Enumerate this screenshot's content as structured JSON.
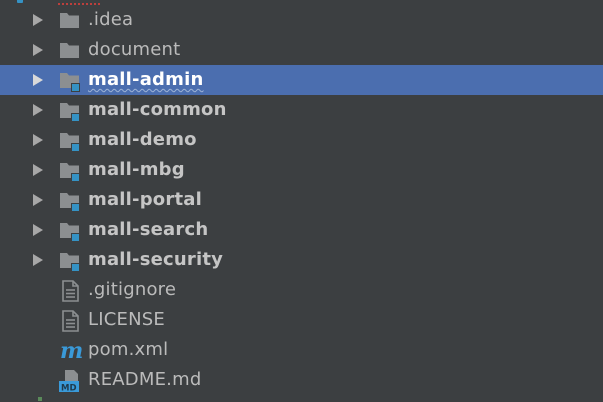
{
  "colors": {
    "background": "#3c3f41",
    "selection": "#4b6eaf",
    "text": "#bbbbbb",
    "folder": "#8c8f91",
    "module_marker": "#3592c4",
    "maven": "#3a9ad9"
  },
  "tree": {
    "items": [
      {
        "label": ".idea",
        "kind": "folder",
        "expandable": true,
        "icon": "folder-icon"
      },
      {
        "label": "document",
        "kind": "folder",
        "expandable": true,
        "icon": "folder-icon"
      },
      {
        "label": "mall-admin",
        "kind": "module",
        "expandable": true,
        "selected": true,
        "icon": "module-folder-icon"
      },
      {
        "label": "mall-common",
        "kind": "module",
        "expandable": true,
        "icon": "module-folder-icon"
      },
      {
        "label": "mall-demo",
        "kind": "module",
        "expandable": true,
        "icon": "module-folder-icon"
      },
      {
        "label": "mall-mbg",
        "kind": "module",
        "expandable": true,
        "icon": "module-folder-icon"
      },
      {
        "label": "mall-portal",
        "kind": "module",
        "expandable": true,
        "icon": "module-folder-icon"
      },
      {
        "label": "mall-search",
        "kind": "module",
        "expandable": true,
        "icon": "module-folder-icon"
      },
      {
        "label": "mall-security",
        "kind": "module",
        "expandable": true,
        "icon": "module-folder-icon"
      },
      {
        "label": ".gitignore",
        "kind": "file",
        "expandable": false,
        "icon": "text-file-icon"
      },
      {
        "label": "LICENSE",
        "kind": "file",
        "expandable": false,
        "icon": "text-file-icon"
      },
      {
        "label": "pom.xml",
        "kind": "maven",
        "expandable": false,
        "icon": "maven-icon"
      },
      {
        "label": "README.md",
        "kind": "markdown",
        "expandable": false,
        "icon": "markdown-file-icon"
      }
    ]
  }
}
